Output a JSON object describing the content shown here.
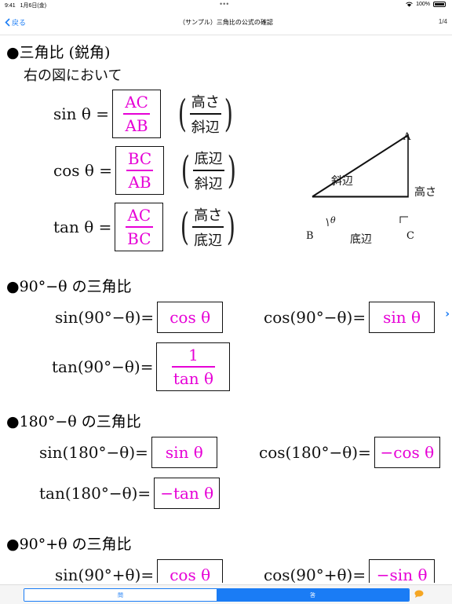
{
  "status": {
    "time": "9:41",
    "date": "1月6日(金)",
    "dots": "•••",
    "battery": "100%"
  },
  "nav": {
    "back": "戻る",
    "title": "（サンプル）三角比の公式の確認",
    "page": "1/4"
  },
  "sections": {
    "s1": {
      "title": "●三角比 (鋭角)",
      "intro": "右の図において"
    },
    "s2": {
      "title": "●90°−θ の三角比"
    },
    "s3": {
      "title": "●180°−θ の三角比"
    },
    "s4": {
      "title": "●90°+θ の三角比"
    }
  },
  "acute": {
    "sin": {
      "lhs": "sin θ =",
      "num": "AC",
      "den": "AB",
      "hint_num": "高さ",
      "hint_den": "斜辺"
    },
    "cos": {
      "lhs": "cos θ =",
      "num": "BC",
      "den": "AB",
      "hint_num": "底辺",
      "hint_den": "斜辺"
    },
    "tan": {
      "lhs": "tan θ =",
      "num": "AC",
      "den": "BC",
      "hint_num": "高さ",
      "hint_den": "底辺"
    }
  },
  "triangle": {
    "A": "A",
    "B": "B",
    "C": "C",
    "theta": "θ",
    "hyp": "斜辺",
    "height": "高さ",
    "base": "底辺"
  },
  "ninety_minus": {
    "sin_lhs": "sin(90°−θ)=",
    "sin_ans": "cos θ",
    "cos_lhs": "cos(90°−θ)=",
    "cos_ans": "sin θ",
    "tan_lhs": "tan(90°−θ)=",
    "tan_num": "1",
    "tan_den": "tan θ"
  },
  "one_eighty_minus": {
    "sin_lhs": "sin(180°−θ)=",
    "sin_ans": "sin θ",
    "cos_lhs": "cos(180°−θ)=",
    "cos_ans": "−cos θ",
    "tan_lhs": "tan(180°−θ)=",
    "tan_ans": "−tan θ"
  },
  "ninety_plus": {
    "sin_lhs": "sin(90°+θ)=",
    "sin_ans": "cos θ",
    "cos_lhs": "cos(90°+θ)=",
    "cos_ans": "−sin θ"
  },
  "bottom": {
    "question": "問",
    "answer": "答"
  },
  "colors": {
    "accent": "#1a7cf5",
    "answer": "#e600d6"
  }
}
